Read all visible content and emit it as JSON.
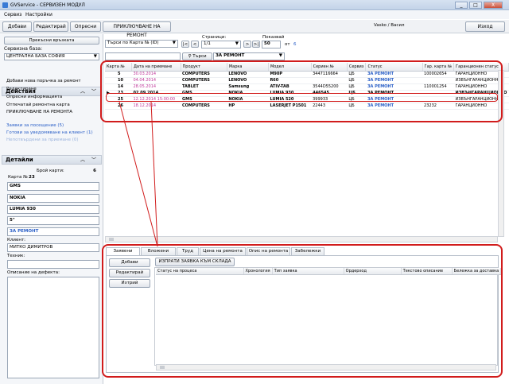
{
  "window": {
    "title": "GVService - СЕРВИЗЕН МОДУЛ",
    "min": "_",
    "max": "□",
    "close": "X"
  },
  "menu": [
    "Сервиз",
    "Настройки"
  ],
  "toolbar": {
    "add": "Добави",
    "edit": "Редактирай",
    "refresh": "Опресни",
    "close_repair": "ПРИКЛЮЧВАНЕ НА РЕМОНТ",
    "user": "Vasko / Васил",
    "exit": "Изход"
  },
  "left": {
    "break_link": "Прекъсни връзката",
    "service_base_label": "Сервизна база:",
    "service_base_value": "ЦЕНТРАЛНА БАЗА СОФИЯ",
    "actions_title": "Действия",
    "actions": [
      "Добави нова поръчка за ремонт",
      "Редактиране",
      "Опресни информацията",
      "Отпечатай ремонтна карта",
      "ПРИКЛЮЧВАНЕ НА РЕМОНТА"
    ],
    "links": [
      "Заявки за посещение (5)",
      "Готови за уведомяване на клиент (1)",
      "Непотвърдени за приемане (0)"
    ],
    "details_title": "Детайли",
    "cards_count_label": "Брой карти:",
    "cards_count_value": "6",
    "card_no_label": "Карта №",
    "card_no_value": "23",
    "detail_values": [
      "GMS",
      "NOKIA",
      "LUMIA 930",
      "5\"",
      "ЗА РЕМОНТ"
    ],
    "client_label": "Клиент:",
    "client_value": "МИТКО ДИМИТРОВ",
    "tech_label": "Техник:",
    "tech_value": "",
    "defect_label": "Описание на дефекта:"
  },
  "search": {
    "search_by": "Търси по Карта № (ID)",
    "pages_label": "Страници:",
    "page_value": "1/1",
    "shown_label": "Показвай",
    "shown_value": "50",
    "of_label": "от",
    "of_value": "6",
    "search_btn": "Търси",
    "status_filter": "ЗА РЕМОНТ",
    "nav": [
      "|<",
      "<",
      ">",
      ">|"
    ]
  },
  "grid": {
    "columns": [
      "Карта №",
      "Дата на приемане",
      "Продукт",
      "Марка",
      "Модел",
      "Сериен №",
      "Сервиз",
      "Статус",
      "Гар. карта №",
      "Гаранционен статус"
    ],
    "rows": [
      [
        "5",
        "30.03.2014",
        "COMPUTERS",
        "LENOVO",
        "M90P",
        "3447116664",
        "ЦБ",
        "ЗА РЕМОНТ",
        "100002654",
        "ГАРАНЦИОННО"
      ],
      [
        "10",
        "04.04.2014",
        "COMPUTERS",
        "LENOVO",
        "R60",
        "",
        "ЦБ",
        "ЗА РЕМОНТ",
        "",
        "ИЗВЪНГАРАНЦИОННО"
      ],
      [
        "14",
        "28.05.2014",
        "TABLET",
        "Samsung",
        "ATIV-TAB",
        "3544D55200",
        "ЦБ",
        "ЗА РЕМОНТ",
        "110001254",
        "ГАРАНЦИОННО"
      ],
      [
        "23",
        "02.09.2014",
        "GMS",
        "NOKIA",
        "LUMIA 930",
        "446545",
        "ЦБ",
        "ЗА РЕМОНТ",
        "",
        "ИЗВЪНГАРАНЦИОННО"
      ],
      [
        "25",
        "12.12.2014 15:00:00",
        "GMS",
        "NOKIA",
        "LUMIA 520",
        "399933",
        "ЦБ",
        "ЗА РЕМОНТ",
        "",
        "ИЗВЪНГАРАНЦИОННО"
      ],
      [
        "26",
        "18.12.2014",
        "COMPUTERS",
        "HP",
        "LASERJET P1501",
        "22443",
        "ЦБ",
        "ЗА РЕМОНТ",
        "23232",
        "ГАРАНЦИОННО"
      ]
    ],
    "selected_row": 3
  },
  "tabs": [
    "Заявени части",
    "Вложени части",
    "Труд",
    "Цена на ремонта",
    "Опис на ремонта",
    "Забележки"
  ],
  "parts": {
    "add": "Добави",
    "edit": "Редактирай",
    "delete": "Изтрий",
    "send_request": "ИЗПРАТИ ЗАЯВКА КЪМ СКЛАДА",
    "columns": [
      "Статус на процеса",
      "Хронология",
      "Тип заявка",
      "Ордерход",
      "Текстово описание",
      "Бележка за доставка"
    ]
  },
  "colors": {
    "highlight": "#d11c1c",
    "link": "#2a5fc7",
    "date": "#c0379a"
  }
}
